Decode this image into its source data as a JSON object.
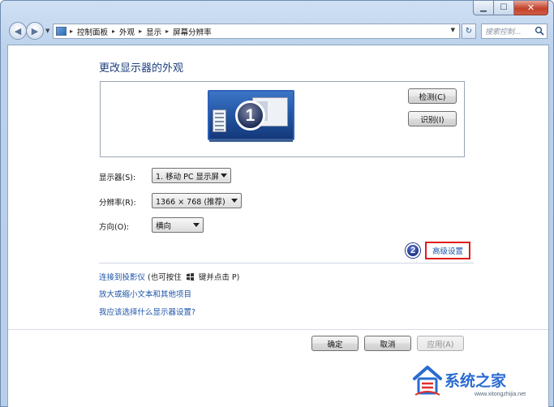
{
  "window": {
    "minimize_icon": "minimize-icon",
    "maximize_icon": "maximize-icon",
    "close_icon": "close-icon"
  },
  "address_bar": {
    "breadcrumbs": [
      "控制面板",
      "外观",
      "显示",
      "屏幕分辨率"
    ],
    "search_placeholder": "搜索控制...",
    "accent": "#1e3f7d"
  },
  "page": {
    "title": "更改显示器的外观",
    "monitor_number": "1",
    "detect_button": "检测(C)",
    "identify_button": "识别(I)",
    "display_label": "显示器(S):",
    "display_value": "1. 移动 PC 显示屏",
    "resolution_label": "分辨率(R):",
    "resolution_value": "1366 × 768 (推荐)",
    "orientation_label": "方向(O):",
    "orientation_value": "横向",
    "annotation_number": "2",
    "advanced_link": "高级设置",
    "highlight_color": "#e21c1c",
    "projector_link": "连接到投影仪",
    "projector_note_pre": "(也可按住",
    "projector_note_post": "键并点击 P)",
    "zoom_link": "放大或缩小文本和其他项目",
    "which_link": "我应该选择什么显示器设置?",
    "link_color": "#1d54a8"
  },
  "footer": {
    "ok": "确定",
    "cancel": "取消",
    "apply": "应用(A)"
  },
  "watermark": {
    "text": "系统之家",
    "url": "www.xitongzhijia.net"
  }
}
